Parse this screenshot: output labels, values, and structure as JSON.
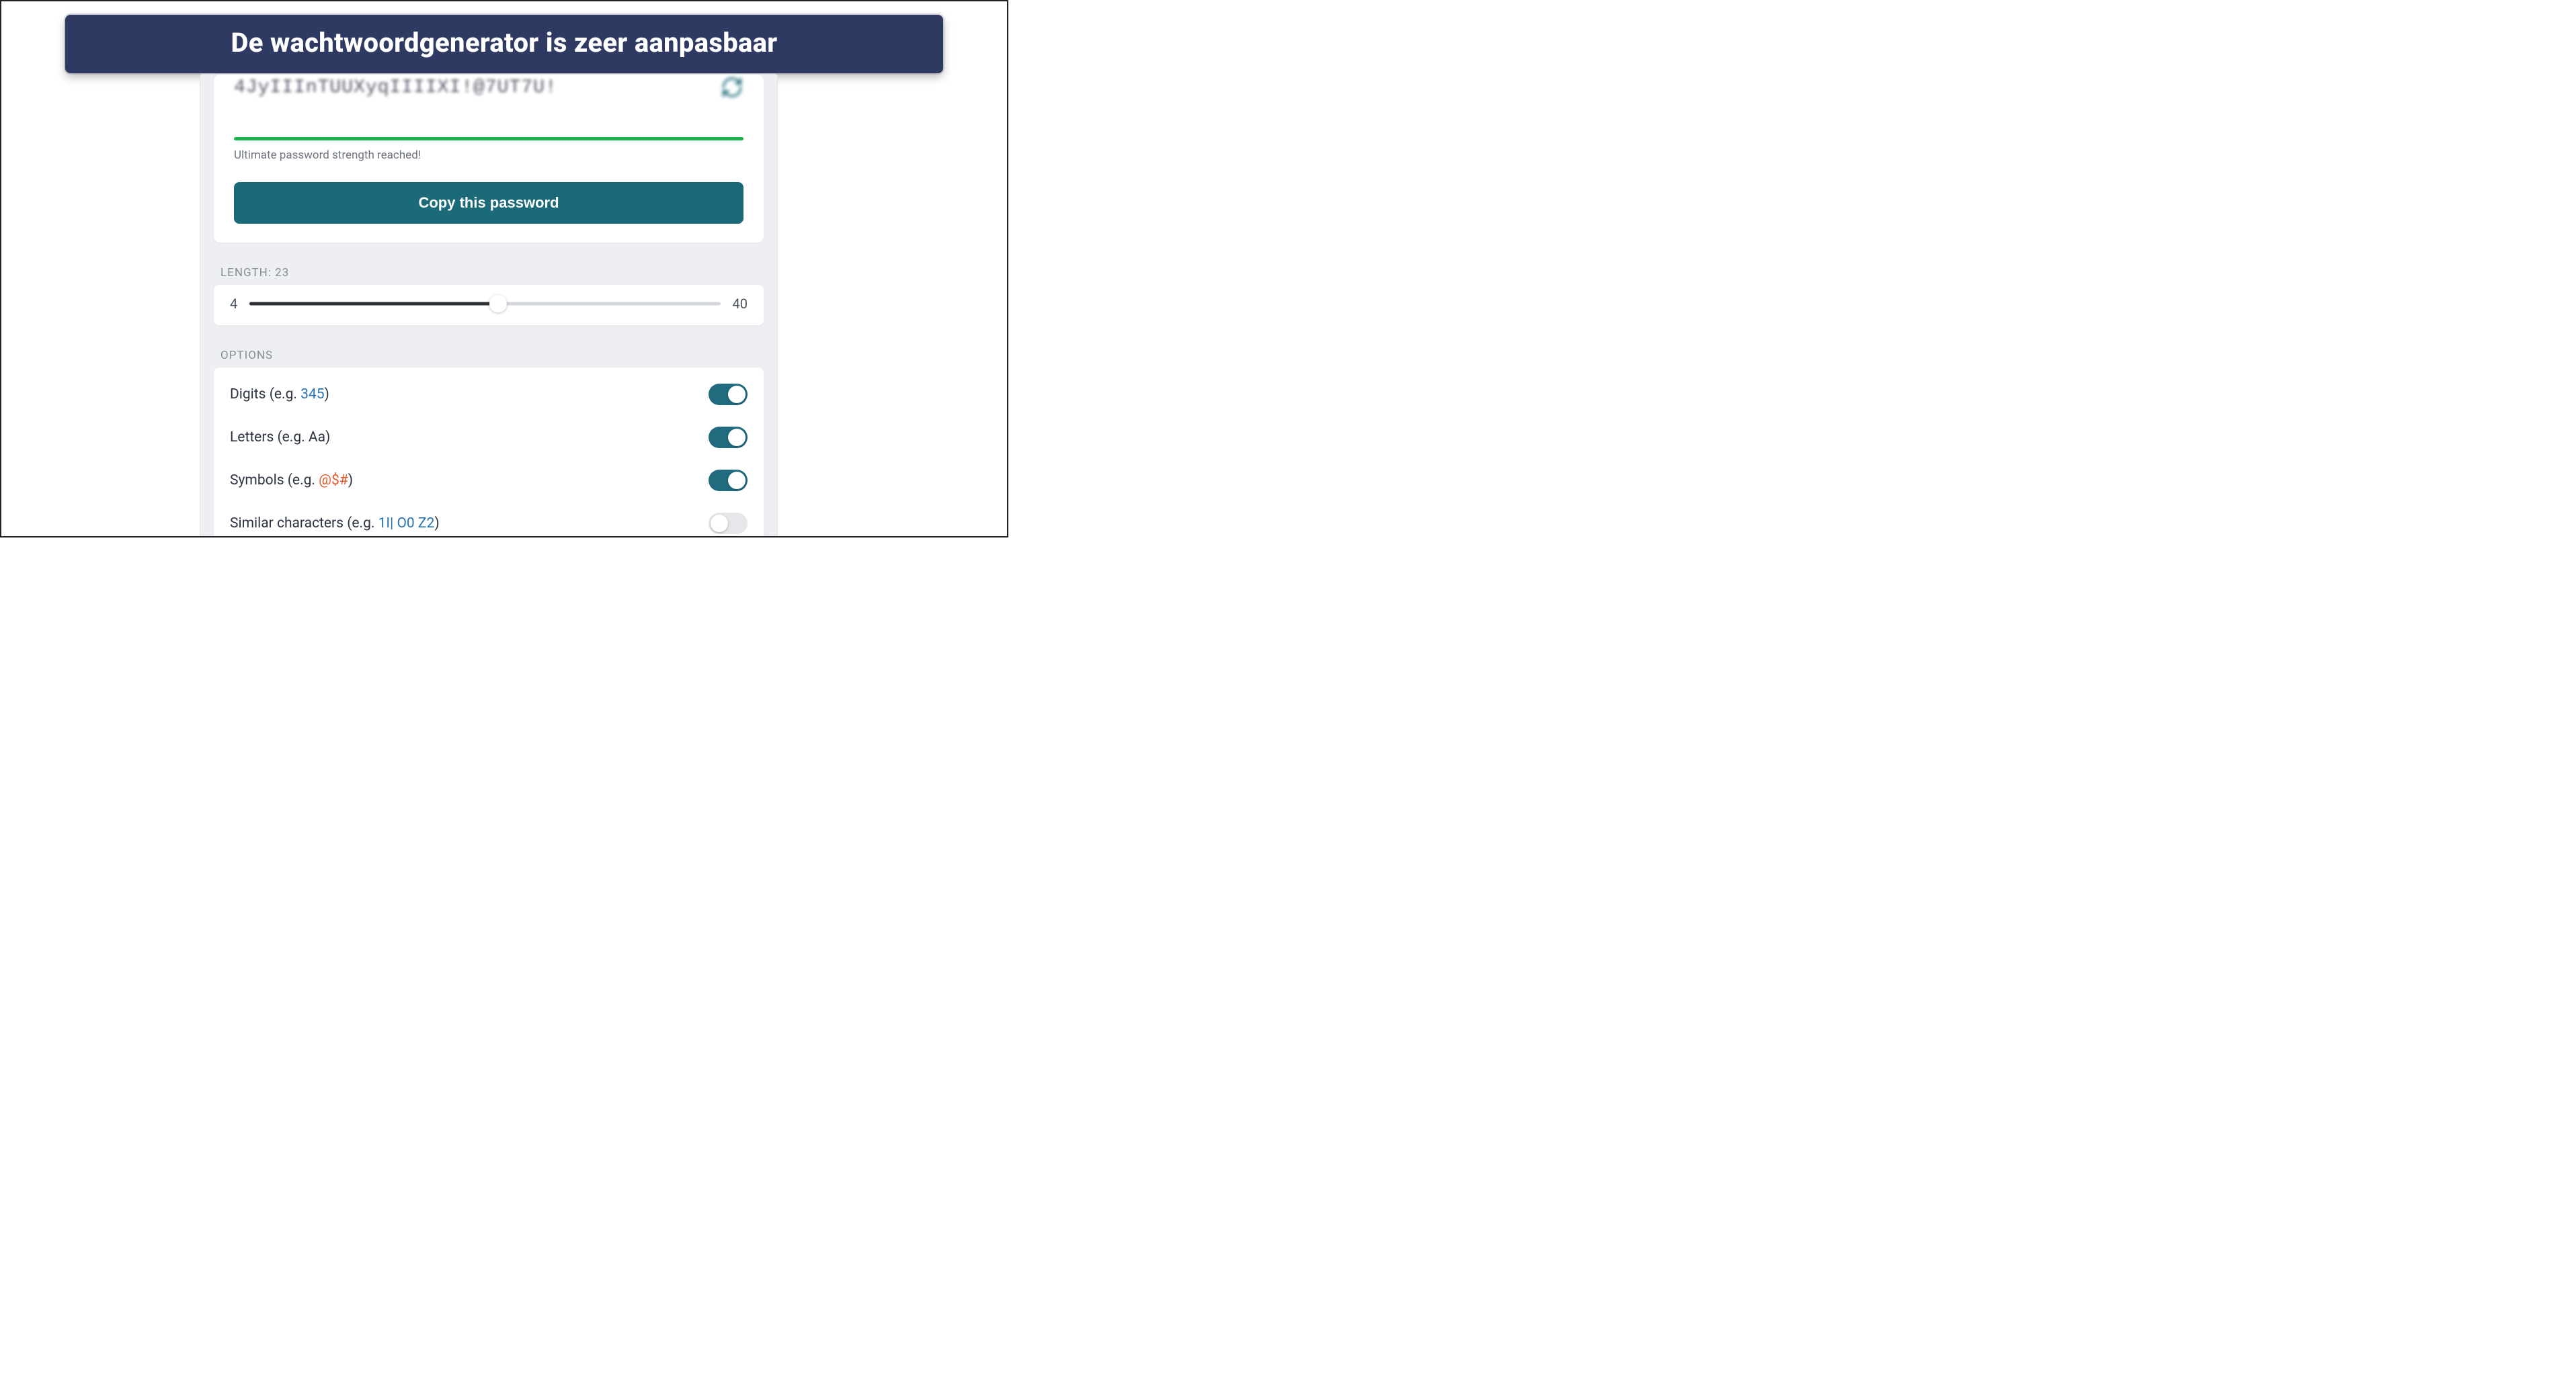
{
  "banner": {
    "title": "De wachtwoordgenerator is zeer aanpasbaar"
  },
  "password": {
    "value_masked": "4JyIIInTUUXyqIIIIXI!@7UT7U!",
    "strength_text": "Ultimate password strength reached!",
    "copy_label": "Copy this password"
  },
  "length": {
    "label_prefix": "LENGTH: ",
    "value": 23,
    "min": 4,
    "max": 40
  },
  "options": {
    "header": "OPTIONS",
    "items": [
      {
        "label_pre": "Digits (e.g. ",
        "sample": "345",
        "sample_class": "d",
        "label_post": ")",
        "on": true
      },
      {
        "label_pre": "Letters (e.g. ",
        "sample": "Aa",
        "sample_class": "",
        "label_post": ")",
        "on": true
      },
      {
        "label_pre": "Symbols (e.g. ",
        "sample": "@$#",
        "sample_class": "s",
        "label_post": ")",
        "on": true
      },
      {
        "label_pre": "Similar characters (e.g. ",
        "sample": "1I| O0 Z2",
        "sample_class": "d",
        "label_post": ")",
        "on": false
      }
    ]
  }
}
